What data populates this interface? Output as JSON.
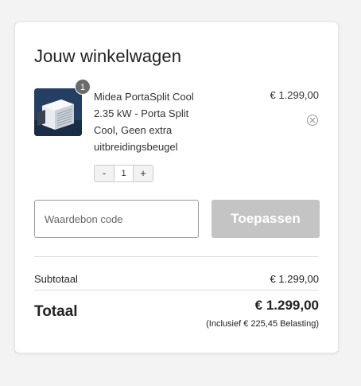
{
  "cart": {
    "title": "Jouw winkelwagen",
    "item": {
      "quantity_badge": "1",
      "name": "Midea PortaSplit Cool 2.35 kW - Porta Split Cool, Geen extra uitbreidingsbeugel",
      "price": "€ 1.299,00",
      "remove_icon": "close-circle-icon",
      "stepper": {
        "minus": "-",
        "value": "1",
        "plus": "+"
      }
    },
    "voucher": {
      "placeholder": "Waardebon code",
      "value": ""
    },
    "apply_label": "Toepassen",
    "subtotal": {
      "label": "Subtotaal",
      "value": "€ 1.299,00"
    },
    "total": {
      "label": "Totaal",
      "value": "€ 1.299,00",
      "tax_note": "(Inclusief € 225,45 Belasting)"
    }
  },
  "colors": {
    "apply_button": "#c4c4c4",
    "badge": "#6b6b6b",
    "background": "#f3f3f3"
  }
}
